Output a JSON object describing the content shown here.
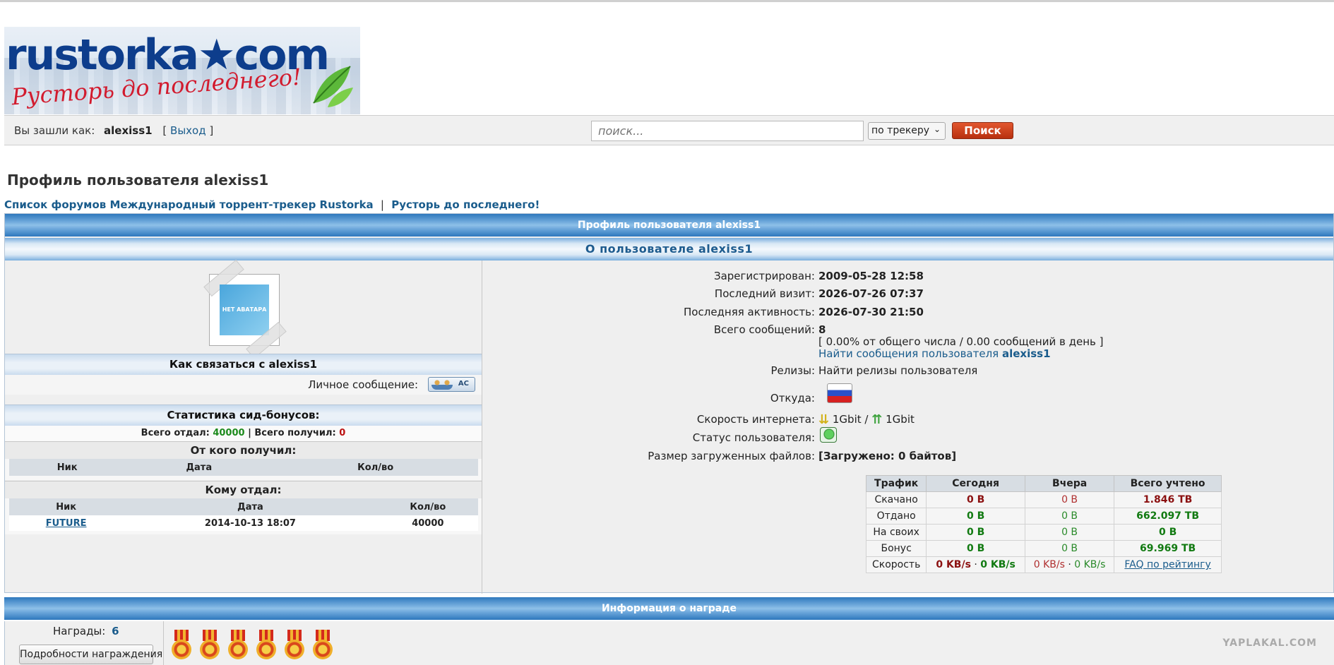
{
  "logo": {
    "brand": "rustorka★com",
    "slogan": "Русторь до последнего!"
  },
  "userbar": {
    "logged_in_label": "Вы зашли как:",
    "username": "alexiss1",
    "bracket_open": "[",
    "logout_label": "Выход",
    "bracket_close": "]"
  },
  "search": {
    "placeholder": "поиск...",
    "scope_value": "по трекеру",
    "button_label": "Поиск"
  },
  "page": {
    "title": "Профиль пользователя alexiss1",
    "breadcrumb_1": "Список форумов Международный торрент-трекер Rustorka",
    "breadcrumb_sep": "|",
    "breadcrumb_2": "Русторь до последнего!"
  },
  "profile": {
    "header": "Профиль пользователя alexiss1",
    "about_header": "О пользователе alexiss1",
    "avatar_text": "НЕТ АВАТАРА",
    "contact_header": "Как связаться с alexiss1",
    "pm_label": "Личное сообщение:",
    "pm_button": "AC",
    "seed_header": "Статистика сид-бонусов:",
    "seed_given_label": "Всего отдал:",
    "seed_given_value": "40000",
    "seed_sep": "|",
    "seed_received_label": "Всего получил:",
    "seed_received_value": "0",
    "from_header": "От кого получил:",
    "to_header": "Кому отдал:",
    "col_nick": "Ник",
    "col_date": "Дата",
    "col_qty": "Кол/во",
    "given_rows": [
      {
        "nick": "FUTURE",
        "date": "2014-10-13 18:07",
        "qty": "40000"
      }
    ]
  },
  "details": {
    "registered_label": "Зарегистрирован:",
    "registered_value": "2009-05-28 12:58",
    "last_visit_label": "Последний визит:",
    "last_visit_value": "2026-07-26 07:37",
    "last_activity_label": "Последняя активность:",
    "last_activity_value": "2026-07-30 21:50",
    "posts_label": "Всего сообщений:",
    "posts_value": "8",
    "posts_stats": "[ 0.00% от общего числа / 0.00 сообщений в день ]",
    "posts_find": "Найти сообщения пользователя",
    "posts_find_user": "alexiss1",
    "releases_label": "Релизы:",
    "releases_link": "Найти релизы пользователя",
    "from_label": "Откуда:",
    "speed_label": "Скорость интернета:",
    "speed_down": "1Gbit",
    "speed_sep": "/",
    "speed_up": "1Gbit",
    "status_label": "Статус пользователя:",
    "uploaded_label": "Размер загруженных файлов:",
    "uploaded_value": "[Загружено: 0 байтов]"
  },
  "traffic": {
    "headers": [
      "Трафик",
      "Сегодня",
      "Вчера",
      "Всего учтено"
    ],
    "rows": [
      {
        "label": "Скачано",
        "today": "0 B",
        "yesterday": "0 B",
        "total": "1.846 TB"
      },
      {
        "label": "Отдано",
        "today": "0 B",
        "yesterday": "0 B",
        "total": "662.097 TB"
      },
      {
        "label": "На своих",
        "today": "0 B",
        "yesterday": "0 B",
        "total": "0 B"
      },
      {
        "label": "Бонус",
        "today": "0 B",
        "yesterday": "0 B",
        "total": "69.969 TB"
      }
    ],
    "speed_label": "Скорость",
    "speed_today_down": "0 KB/s",
    "speed_today_up": "0 KB/s",
    "speed_y_down": "0 KB/s",
    "speed_y_up": "0 KB/s",
    "dot": "·",
    "faq_link": "FAQ по рейтингу"
  },
  "awards": {
    "header": "Информация о награде",
    "count_label": "Награды:",
    "count_value": "6",
    "details_button": "Подробности награждения"
  },
  "watermark": "YAPLAKAL.COM",
  "colors": {
    "link": "#1a5c8c",
    "positive": "#117a11",
    "negative": "#8b1010",
    "search_button": "#c4381a"
  }
}
